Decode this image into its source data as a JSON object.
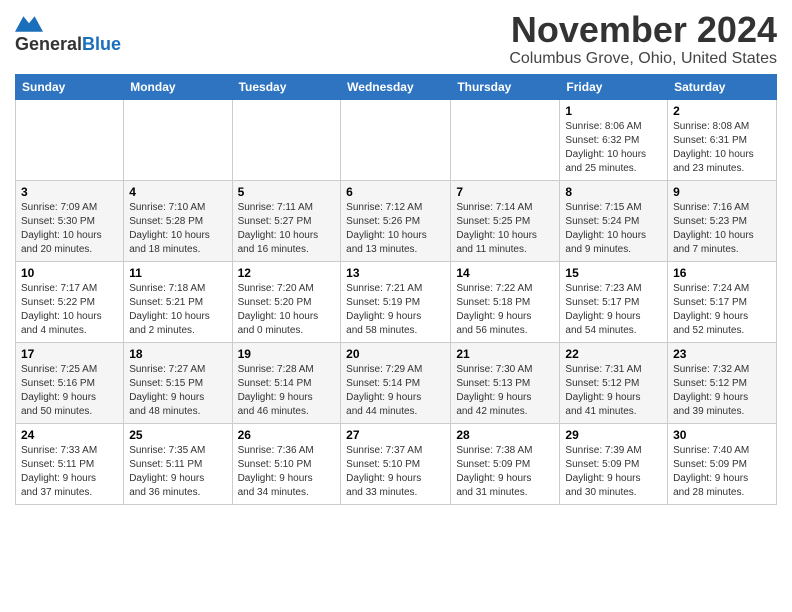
{
  "header": {
    "logo_line1": "General",
    "logo_line2": "Blue",
    "month": "November 2024",
    "location": "Columbus Grove, Ohio, United States"
  },
  "weekdays": [
    "Sunday",
    "Monday",
    "Tuesday",
    "Wednesday",
    "Thursday",
    "Friday",
    "Saturday"
  ],
  "weeks": [
    [
      {
        "day": "",
        "details": ""
      },
      {
        "day": "",
        "details": ""
      },
      {
        "day": "",
        "details": ""
      },
      {
        "day": "",
        "details": ""
      },
      {
        "day": "",
        "details": ""
      },
      {
        "day": "1",
        "details": "Sunrise: 8:06 AM\nSunset: 6:32 PM\nDaylight: 10 hours\nand 25 minutes."
      },
      {
        "day": "2",
        "details": "Sunrise: 8:08 AM\nSunset: 6:31 PM\nDaylight: 10 hours\nand 23 minutes."
      }
    ],
    [
      {
        "day": "3",
        "details": "Sunrise: 7:09 AM\nSunset: 5:30 PM\nDaylight: 10 hours\nand 20 minutes."
      },
      {
        "day": "4",
        "details": "Sunrise: 7:10 AM\nSunset: 5:28 PM\nDaylight: 10 hours\nand 18 minutes."
      },
      {
        "day": "5",
        "details": "Sunrise: 7:11 AM\nSunset: 5:27 PM\nDaylight: 10 hours\nand 16 minutes."
      },
      {
        "day": "6",
        "details": "Sunrise: 7:12 AM\nSunset: 5:26 PM\nDaylight: 10 hours\nand 13 minutes."
      },
      {
        "day": "7",
        "details": "Sunrise: 7:14 AM\nSunset: 5:25 PM\nDaylight: 10 hours\nand 11 minutes."
      },
      {
        "day": "8",
        "details": "Sunrise: 7:15 AM\nSunset: 5:24 PM\nDaylight: 10 hours\nand 9 minutes."
      },
      {
        "day": "9",
        "details": "Sunrise: 7:16 AM\nSunset: 5:23 PM\nDaylight: 10 hours\nand 7 minutes."
      }
    ],
    [
      {
        "day": "10",
        "details": "Sunrise: 7:17 AM\nSunset: 5:22 PM\nDaylight: 10 hours\nand 4 minutes."
      },
      {
        "day": "11",
        "details": "Sunrise: 7:18 AM\nSunset: 5:21 PM\nDaylight: 10 hours\nand 2 minutes."
      },
      {
        "day": "12",
        "details": "Sunrise: 7:20 AM\nSunset: 5:20 PM\nDaylight: 10 hours\nand 0 minutes."
      },
      {
        "day": "13",
        "details": "Sunrise: 7:21 AM\nSunset: 5:19 PM\nDaylight: 9 hours\nand 58 minutes."
      },
      {
        "day": "14",
        "details": "Sunrise: 7:22 AM\nSunset: 5:18 PM\nDaylight: 9 hours\nand 56 minutes."
      },
      {
        "day": "15",
        "details": "Sunrise: 7:23 AM\nSunset: 5:17 PM\nDaylight: 9 hours\nand 54 minutes."
      },
      {
        "day": "16",
        "details": "Sunrise: 7:24 AM\nSunset: 5:17 PM\nDaylight: 9 hours\nand 52 minutes."
      }
    ],
    [
      {
        "day": "17",
        "details": "Sunrise: 7:25 AM\nSunset: 5:16 PM\nDaylight: 9 hours\nand 50 minutes."
      },
      {
        "day": "18",
        "details": "Sunrise: 7:27 AM\nSunset: 5:15 PM\nDaylight: 9 hours\nand 48 minutes."
      },
      {
        "day": "19",
        "details": "Sunrise: 7:28 AM\nSunset: 5:14 PM\nDaylight: 9 hours\nand 46 minutes."
      },
      {
        "day": "20",
        "details": "Sunrise: 7:29 AM\nSunset: 5:14 PM\nDaylight: 9 hours\nand 44 minutes."
      },
      {
        "day": "21",
        "details": "Sunrise: 7:30 AM\nSunset: 5:13 PM\nDaylight: 9 hours\nand 42 minutes."
      },
      {
        "day": "22",
        "details": "Sunrise: 7:31 AM\nSunset: 5:12 PM\nDaylight: 9 hours\nand 41 minutes."
      },
      {
        "day": "23",
        "details": "Sunrise: 7:32 AM\nSunset: 5:12 PM\nDaylight: 9 hours\nand 39 minutes."
      }
    ],
    [
      {
        "day": "24",
        "details": "Sunrise: 7:33 AM\nSunset: 5:11 PM\nDaylight: 9 hours\nand 37 minutes."
      },
      {
        "day": "25",
        "details": "Sunrise: 7:35 AM\nSunset: 5:11 PM\nDaylight: 9 hours\nand 36 minutes."
      },
      {
        "day": "26",
        "details": "Sunrise: 7:36 AM\nSunset: 5:10 PM\nDaylight: 9 hours\nand 34 minutes."
      },
      {
        "day": "27",
        "details": "Sunrise: 7:37 AM\nSunset: 5:10 PM\nDaylight: 9 hours\nand 33 minutes."
      },
      {
        "day": "28",
        "details": "Sunrise: 7:38 AM\nSunset: 5:09 PM\nDaylight: 9 hours\nand 31 minutes."
      },
      {
        "day": "29",
        "details": "Sunrise: 7:39 AM\nSunset: 5:09 PM\nDaylight: 9 hours\nand 30 minutes."
      },
      {
        "day": "30",
        "details": "Sunrise: 7:40 AM\nSunset: 5:09 PM\nDaylight: 9 hours\nand 28 minutes."
      }
    ]
  ]
}
